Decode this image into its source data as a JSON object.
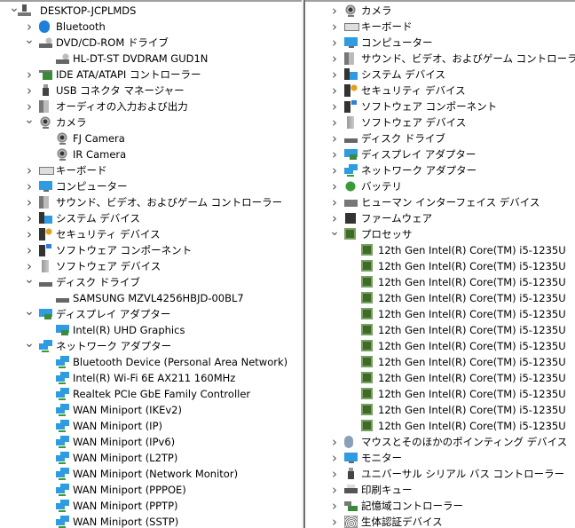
{
  "left_tree": [
    {
      "label": "DESKTOP-JCPLMDS",
      "level": 0,
      "expanded": true,
      "icon": "computer-root-icon"
    },
    {
      "label": "Bluetooth",
      "level": 1,
      "expanded": false,
      "icon": "bluetooth-icon"
    },
    {
      "label": "DVD/CD-ROM ドライブ",
      "level": 1,
      "expanded": true,
      "icon": "dvd-drive-icon"
    },
    {
      "label": "HL-DT-ST DVDRAM GUD1N",
      "level": 2,
      "icon": "dvd-drive-icon"
    },
    {
      "label": "IDE ATA/ATAPI コントローラー",
      "level": 1,
      "expanded": false,
      "icon": "ide-controller-icon"
    },
    {
      "label": "USB コネクタ マネージャー",
      "level": 1,
      "expanded": false,
      "icon": "usb-icon"
    },
    {
      "label": "オーディオの入力および出力",
      "level": 1,
      "expanded": false,
      "icon": "speaker-icon"
    },
    {
      "label": "カメラ",
      "level": 1,
      "expanded": true,
      "icon": "camera-icon"
    },
    {
      "label": "FJ Camera",
      "level": 2,
      "icon": "camera-icon"
    },
    {
      "label": "IR Camera",
      "level": 2,
      "icon": "camera-icon"
    },
    {
      "label": "キーボード",
      "level": 1,
      "expanded": false,
      "icon": "keyboard-icon"
    },
    {
      "label": "コンピューター",
      "level": 1,
      "expanded": false,
      "icon": "monitor-icon"
    },
    {
      "label": "サウンド、ビデオ、およびゲーム コントローラー",
      "level": 1,
      "expanded": false,
      "icon": "speaker-icon"
    },
    {
      "label": "システム デバイス",
      "level": 1,
      "expanded": false,
      "icon": "system-device-icon"
    },
    {
      "label": "セキュリティ デバイス",
      "level": 1,
      "expanded": false,
      "icon": "security-key-icon"
    },
    {
      "label": "ソフトウェア コンポーネント",
      "level": 1,
      "expanded": false,
      "icon": "software-component-icon"
    },
    {
      "label": "ソフトウェア デバイス",
      "level": 1,
      "expanded": false,
      "icon": "software-device-icon"
    },
    {
      "label": "ディスク ドライブ",
      "level": 1,
      "expanded": true,
      "icon": "disk-drive-icon"
    },
    {
      "label": "SAMSUNG MZVL4256HBJD-00BL7",
      "level": 2,
      "icon": "disk-drive-icon"
    },
    {
      "label": "ディスプレイ アダプター",
      "level": 1,
      "expanded": true,
      "icon": "display-adapter-icon"
    },
    {
      "label": "Intel(R) UHD Graphics",
      "level": 2,
      "icon": "display-adapter-icon"
    },
    {
      "label": "ネットワーク アダプター",
      "level": 1,
      "expanded": true,
      "icon": "network-adapter-icon"
    },
    {
      "label": "Bluetooth Device (Personal Area Network)",
      "level": 2,
      "icon": "network-adapter-icon"
    },
    {
      "label": "Intel(R) Wi-Fi 6E AX211 160MHz",
      "level": 2,
      "icon": "network-adapter-icon"
    },
    {
      "label": "Realtek PCIe GbE Family Controller",
      "level": 2,
      "icon": "network-adapter-icon"
    },
    {
      "label": "WAN Miniport (IKEv2)",
      "level": 2,
      "icon": "network-adapter-icon"
    },
    {
      "label": "WAN Miniport (IP)",
      "level": 2,
      "icon": "network-adapter-icon"
    },
    {
      "label": "WAN Miniport (IPv6)",
      "level": 2,
      "icon": "network-adapter-icon"
    },
    {
      "label": "WAN Miniport (L2TP)",
      "level": 2,
      "icon": "network-adapter-icon"
    },
    {
      "label": "WAN Miniport (Network Monitor)",
      "level": 2,
      "icon": "network-adapter-icon"
    },
    {
      "label": "WAN Miniport (PPPOE)",
      "level": 2,
      "icon": "network-adapter-icon"
    },
    {
      "label": "WAN Miniport (PPTP)",
      "level": 2,
      "icon": "network-adapter-icon"
    },
    {
      "label": "WAN Miniport (SSTP)",
      "level": 2,
      "icon": "network-adapter-icon"
    }
  ],
  "right_tree": [
    {
      "label": "カメラ",
      "level": 1,
      "expanded": false,
      "icon": "camera-icon"
    },
    {
      "label": "キーボード",
      "level": 1,
      "expanded": false,
      "icon": "keyboard-icon"
    },
    {
      "label": "コンピューター",
      "level": 1,
      "expanded": false,
      "icon": "monitor-icon"
    },
    {
      "label": "サウンド、ビデオ、およびゲーム コントローラー",
      "level": 1,
      "expanded": false,
      "icon": "speaker-icon"
    },
    {
      "label": "システム デバイス",
      "level": 1,
      "expanded": false,
      "icon": "system-device-icon"
    },
    {
      "label": "セキュリティ デバイス",
      "level": 1,
      "expanded": false,
      "icon": "security-key-icon"
    },
    {
      "label": "ソフトウェア コンポーネント",
      "level": 1,
      "expanded": false,
      "icon": "software-component-icon"
    },
    {
      "label": "ソフトウェア デバイス",
      "level": 1,
      "expanded": false,
      "icon": "software-device-icon"
    },
    {
      "label": "ディスク ドライブ",
      "level": 1,
      "expanded": false,
      "icon": "disk-drive-icon"
    },
    {
      "label": "ディスプレイ アダプター",
      "level": 1,
      "expanded": false,
      "icon": "display-adapter-icon"
    },
    {
      "label": "ネットワーク アダプター",
      "level": 1,
      "expanded": false,
      "icon": "network-adapter-icon"
    },
    {
      "label": "バッテリ",
      "level": 1,
      "expanded": false,
      "icon": "battery-icon"
    },
    {
      "label": "ヒューマン インターフェイス デバイス",
      "level": 1,
      "expanded": false,
      "icon": "hid-icon"
    },
    {
      "label": "ファームウェア",
      "level": 1,
      "expanded": false,
      "icon": "firmware-icon"
    },
    {
      "label": "プロセッサ",
      "level": 1,
      "expanded": true,
      "icon": "processor-icon"
    },
    {
      "label": "12th Gen Intel(R) Core(TM) i5-1235U",
      "level": 2,
      "icon": "processor-icon"
    },
    {
      "label": "12th Gen Intel(R) Core(TM) i5-1235U",
      "level": 2,
      "icon": "processor-icon"
    },
    {
      "label": "12th Gen Intel(R) Core(TM) i5-1235U",
      "level": 2,
      "icon": "processor-icon"
    },
    {
      "label": "12th Gen Intel(R) Core(TM) i5-1235U",
      "level": 2,
      "icon": "processor-icon"
    },
    {
      "label": "12th Gen Intel(R) Core(TM) i5-1235U",
      "level": 2,
      "icon": "processor-icon"
    },
    {
      "label": "12th Gen Intel(R) Core(TM) i5-1235U",
      "level": 2,
      "icon": "processor-icon"
    },
    {
      "label": "12th Gen Intel(R) Core(TM) i5-1235U",
      "level": 2,
      "icon": "processor-icon"
    },
    {
      "label": "12th Gen Intel(R) Core(TM) i5-1235U",
      "level": 2,
      "icon": "processor-icon"
    },
    {
      "label": "12th Gen Intel(R) Core(TM) i5-1235U",
      "level": 2,
      "icon": "processor-icon"
    },
    {
      "label": "12th Gen Intel(R) Core(TM) i5-1235U",
      "level": 2,
      "icon": "processor-icon"
    },
    {
      "label": "12th Gen Intel(R) Core(TM) i5-1235U",
      "level": 2,
      "icon": "processor-icon"
    },
    {
      "label": "12th Gen Intel(R) Core(TM) i5-1235U",
      "level": 2,
      "icon": "processor-icon"
    },
    {
      "label": "マウスとそのほかのポインティング デバイス",
      "level": 1,
      "expanded": false,
      "icon": "mouse-icon"
    },
    {
      "label": "モニター",
      "level": 1,
      "expanded": false,
      "icon": "monitor-icon"
    },
    {
      "label": "ユニバーサル シリアル バス コントローラー",
      "level": 1,
      "expanded": false,
      "icon": "usb-icon"
    },
    {
      "label": "印刷キュー",
      "level": 1,
      "expanded": false,
      "icon": "printer-icon"
    },
    {
      "label": "記憶域コントローラー",
      "level": 1,
      "expanded": false,
      "icon": "storage-controller-icon"
    },
    {
      "label": "生体認証デバイス",
      "level": 1,
      "expanded": false,
      "icon": "fingerprint-icon"
    }
  ]
}
